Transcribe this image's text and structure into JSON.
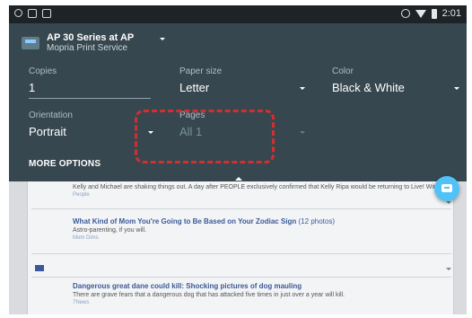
{
  "status_bar": {
    "time": "2:01"
  },
  "printer": {
    "name": "AP 30 Series at AP",
    "service": "Mopria Print Service"
  },
  "copies": {
    "label": "Copies",
    "value": "1"
  },
  "paper_size": {
    "label": "Paper size",
    "value": "Letter"
  },
  "color": {
    "label": "Color",
    "value": "Black & White"
  },
  "orientation": {
    "label": "Orientation",
    "value": "Portrait"
  },
  "pages": {
    "label": "Pages",
    "value": "All 1"
  },
  "more_options_label": "MORE OPTIONS",
  "preview": {
    "articles": [
      {
        "snippet": "Kelly and Michael are shaking things out. A day after PEOPLE exclusively confirmed that Kelly Ripa would be returning to Live! With Kelly and Michael after a nearly weeklong absence, a source says Michael Strahan is excited to have her back.",
        "source": "People"
      },
      {
        "title": "What Kind of Mom You're Going to Be Based on Your Zodiac Sign",
        "count": "(12 photos)",
        "snippet": "Astro-parenting, if you will.",
        "source": "Mom Dims"
      },
      {
        "title": "Dangerous great dane could kill: Shocking pictures of dog mauling",
        "snippet": "There are grave fears that a dangerous dog that has attacked five times in just over a year will kill.",
        "source": "7News"
      }
    ]
  }
}
